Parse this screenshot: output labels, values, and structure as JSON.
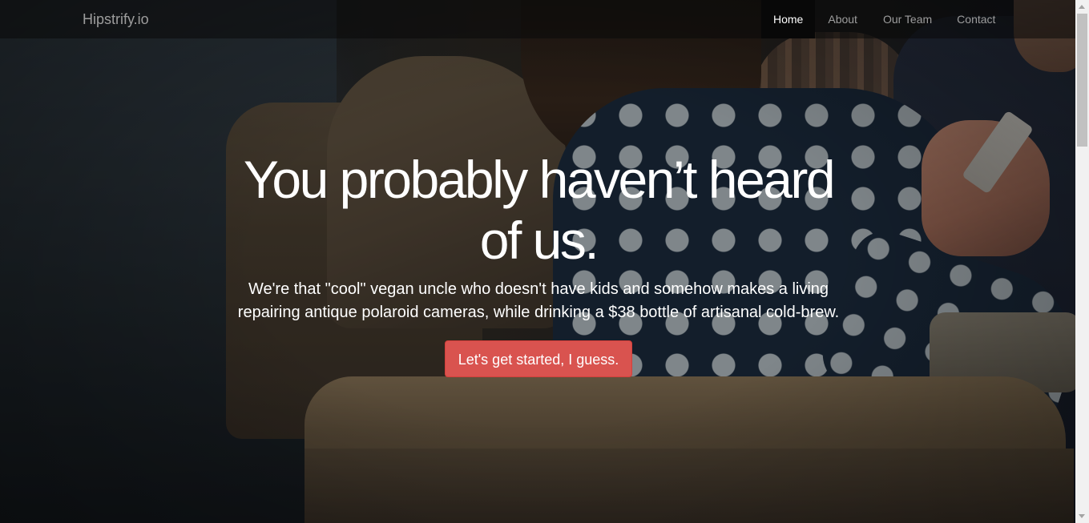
{
  "navbar": {
    "brand": "Hipstrify.io",
    "items": [
      {
        "label": "Home",
        "active": true
      },
      {
        "label": "About",
        "active": false
      },
      {
        "label": "Our Team",
        "active": false
      },
      {
        "label": "Contact",
        "active": false
      }
    ]
  },
  "hero": {
    "title": "You probably haven’t heard of us.",
    "subtitle": "We're that \"cool\" vegan uncle who doesn't have kids and somehow makes a living repairing antique polaroid cameras, while drinking a $38 bottle of artisanal cold-brew.",
    "cta_label": "Let's get started, I guess."
  },
  "colors": {
    "cta_background": "#d9534f",
    "navbar_active_background": "#080808",
    "navbar_text": "#9d9d9d"
  },
  "scrollbar": {
    "icons": [
      "scroll-up-arrow-icon",
      "scroll-down-arrow-icon"
    ]
  }
}
